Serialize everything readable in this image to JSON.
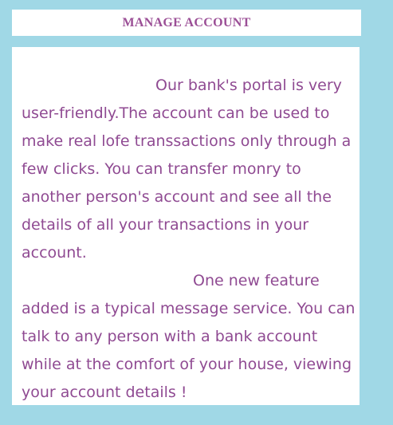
{
  "header": {
    "title": "MANAGE ACCOUNT"
  },
  "content": {
    "paragraph_1": "Our bank's portal is very user-friendly.The account can be used to make real lofe transsactions only through a few clicks. You can transfer monry to another person's account and see all the details of all your transactions in your account.",
    "paragraph_2": "One new feature added is a typical message service. You can talk to any person with a bank account while at the comfort of your house, viewing your account details !"
  },
  "colors": {
    "background": "#a0d8e6",
    "panel": "#ffffff",
    "text": "#8f4a92"
  }
}
